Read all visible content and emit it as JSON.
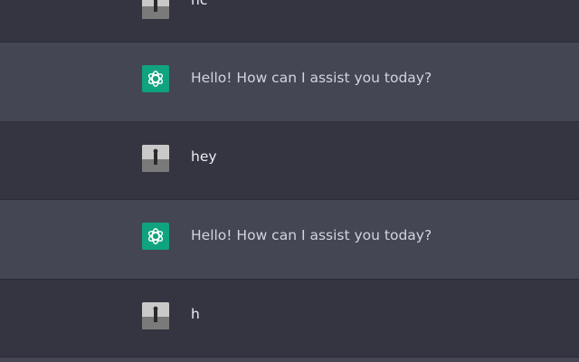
{
  "colors": {
    "user_row_bg": "#343541",
    "assistant_row_bg": "#444654",
    "assistant_avatar_bg": "#10a37f",
    "text": "#d1d5db"
  },
  "messages": [
    {
      "role": "user",
      "avatar": "user-photo-avatar",
      "text": "hc"
    },
    {
      "role": "assistant",
      "avatar": "openai-logo-icon",
      "text": "Hello! How can I assist you today?"
    },
    {
      "role": "user",
      "avatar": "user-photo-avatar",
      "text": "hey"
    },
    {
      "role": "assistant",
      "avatar": "openai-logo-icon",
      "text": "Hello! How can I assist you today?"
    },
    {
      "role": "user",
      "avatar": "user-photo-avatar",
      "text": "h"
    }
  ]
}
